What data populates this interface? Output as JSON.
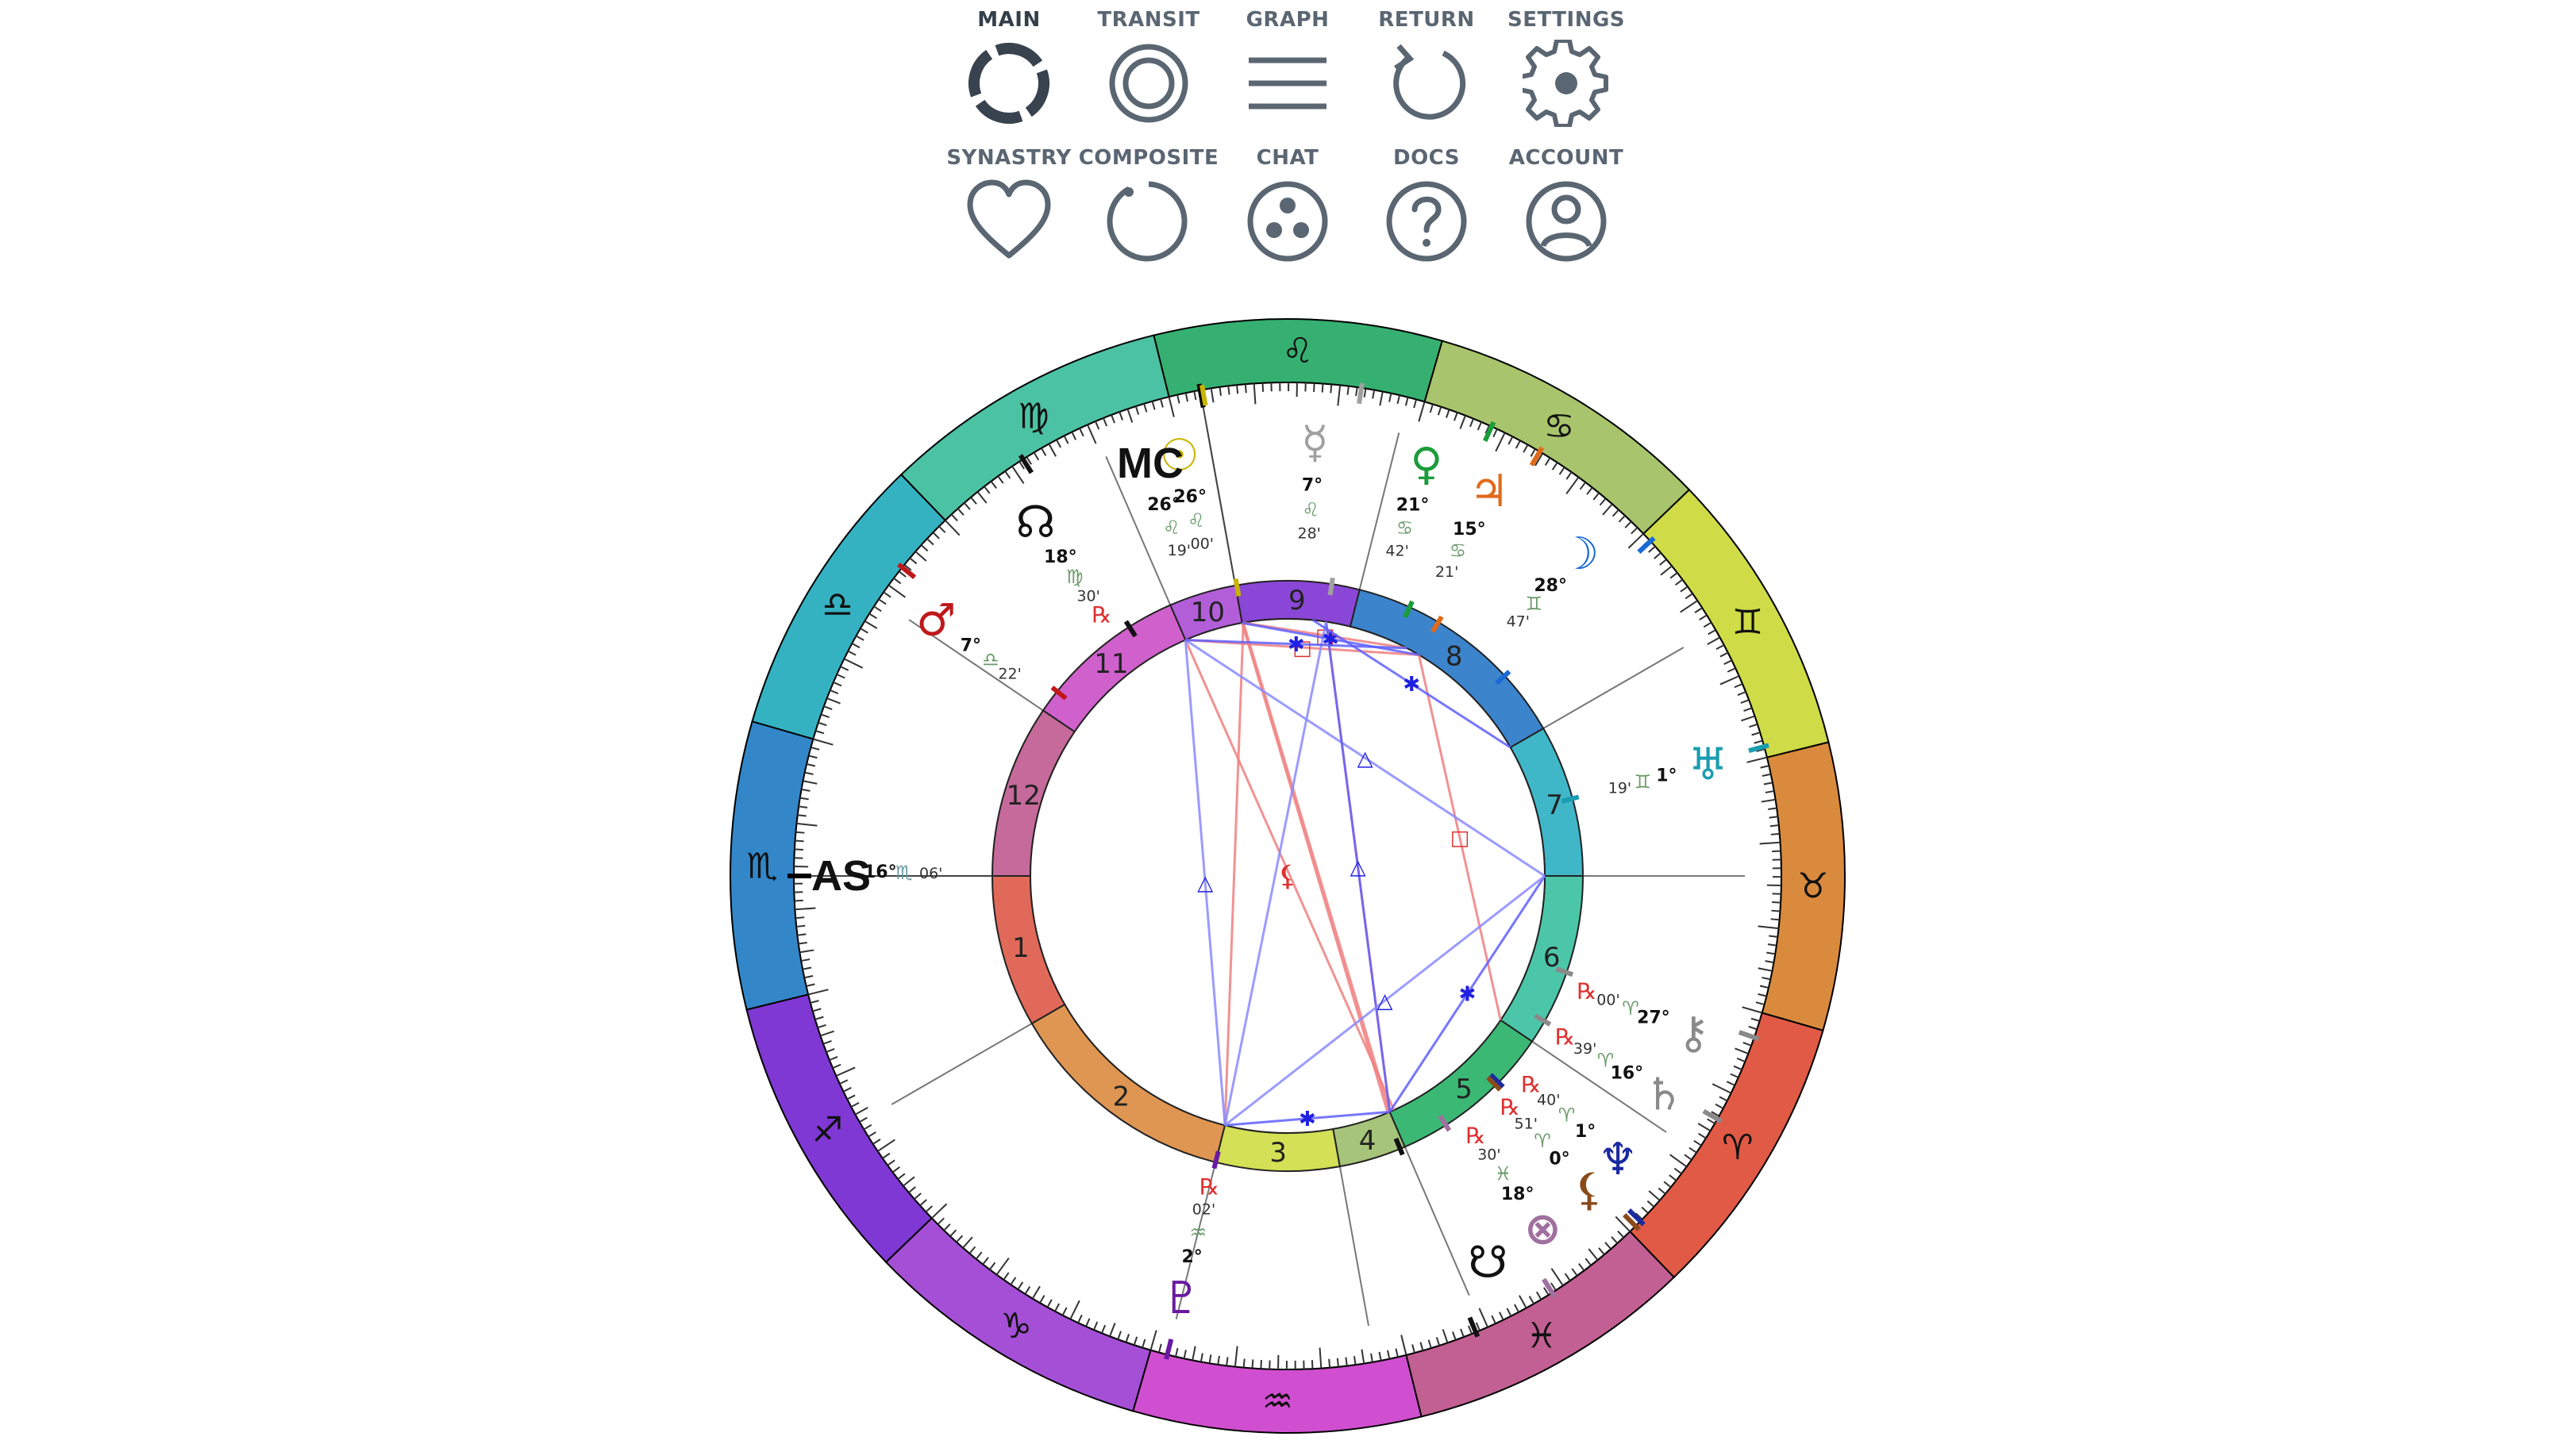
{
  "nav": [
    {
      "label": "MAIN",
      "icon": "main-chart-icon",
      "active": true
    },
    {
      "label": "TRANSIT",
      "icon": "transit-icon",
      "active": false
    },
    {
      "label": "GRAPH",
      "icon": "graph-lines-icon",
      "active": false
    },
    {
      "label": "RETURN",
      "icon": "return-arrow-icon",
      "active": false
    },
    {
      "label": "SETTINGS",
      "icon": "gear-icon",
      "active": false
    },
    {
      "label": "SYNASTRY",
      "icon": "heart-icon",
      "active": false
    },
    {
      "label": "COMPOSITE",
      "icon": "composite-circle-icon",
      "active": false
    },
    {
      "label": "CHAT",
      "icon": "chat-dots-icon",
      "active": false
    },
    {
      "label": "DOCS",
      "icon": "question-icon",
      "active": false
    },
    {
      "label": "ACCOUNT",
      "icon": "account-icon",
      "active": false
    }
  ],
  "chart": {
    "ascendant_longitude": 226.1,
    "signs": [
      {
        "name": "Aries",
        "glyph": "♈",
        "color": "#e05a45"
      },
      {
        "name": "Taurus",
        "glyph": "♉",
        "color": "#d98a3d"
      },
      {
        "name": "Gemini",
        "glyph": "♊",
        "color": "#cfdb47"
      },
      {
        "name": "Cancer",
        "glyph": "♋",
        "color": "#a8c46c"
      },
      {
        "name": "Leo",
        "glyph": "♌",
        "color": "#35b071"
      },
      {
        "name": "Virgo",
        "glyph": "♍",
        "color": "#4cc2a4"
      },
      {
        "name": "Libra",
        "glyph": "♎",
        "color": "#35b2c2"
      },
      {
        "name": "Scorpio",
        "glyph": "♏",
        "color": "#3387c8"
      },
      {
        "name": "Sagittarius",
        "glyph": "♐",
        "color": "#7f38d3"
      },
      {
        "name": "Capricorn",
        "glyph": "♑",
        "color": "#a44fd6"
      },
      {
        "name": "Aquarius",
        "glyph": "♒",
        "color": "#d04ed0"
      },
      {
        "name": "Pisces",
        "glyph": "♓",
        "color": "#c25f93"
      }
    ],
    "houses": [
      {
        "num": "1",
        "cusp": 226.1,
        "color": "#e0695a"
      },
      {
        "num": "2",
        "cusp": 256.1,
        "color": "#df9652"
      },
      {
        "num": "3",
        "cusp": 302.0,
        "color": "#d4e055"
      },
      {
        "num": "4",
        "cusp": 326.3,
        "color": "#a6c47a"
      },
      {
        "num": "5",
        "cusp": 339.5,
        "color": "#3cb875"
      },
      {
        "num": "6",
        "cusp": 12.0,
        "color": "#4cc6a9"
      },
      {
        "num": "7",
        "cusp": 46.1,
        "color": "#3fb7c8"
      },
      {
        "num": "8",
        "cusp": 76.1,
        "color": "#3c84cc"
      },
      {
        "num": "9",
        "cusp": 122.0,
        "color": "#8a46d6"
      },
      {
        "num": "10",
        "cusp": 146.3,
        "color": "#b35ed9"
      },
      {
        "num": "11",
        "cusp": 159.5,
        "color": "#cf60cc"
      },
      {
        "num": "12",
        "cusp": 192.0,
        "color": "#c56a9a"
      }
    ],
    "angles": [
      {
        "name": "AS",
        "glyph": "AS",
        "deg": "16°",
        "sign": "♏",
        "min": "06'",
        "lon": 226.1
      },
      {
        "name": "MC",
        "glyph": "MC",
        "deg": "26°",
        "sign": "♌",
        "min": "19'",
        "lon": 146.3
      }
    ],
    "planets": [
      {
        "name": "Sun",
        "glyph": "☉",
        "color": "#c8b400",
        "deg": "26°",
        "sign": "♌",
        "min": "00'",
        "retro": false,
        "lon": 146.0
      },
      {
        "name": "Mercury",
        "glyph": "☿",
        "color": "#a0a0a0",
        "deg": "7°",
        "sign": "♌",
        "min": "28'",
        "retro": false,
        "lon": 127.5
      },
      {
        "name": "Venus",
        "glyph": "♀",
        "color": "#1a9c3a",
        "deg": "21°",
        "sign": "♋",
        "min": "42'",
        "retro": false,
        "lon": 111.7
      },
      {
        "name": "Jupiter",
        "glyph": "♃",
        "color": "#e06a1a",
        "deg": "15°",
        "sign": "♋",
        "min": "21'",
        "retro": false,
        "lon": 105.4
      },
      {
        "name": "Moon",
        "glyph": "☽",
        "color": "#1a6ad4",
        "deg": "28°",
        "sign": "♊",
        "min": "47'",
        "retro": false,
        "lon": 88.8
      },
      {
        "name": "Uranus",
        "glyph": "♅",
        "color": "#1a9cb0",
        "deg": "1°",
        "sign": "♊",
        "min": "19'",
        "retro": false,
        "lon": 61.3
      },
      {
        "name": "Chiron",
        "glyph": "⚷",
        "color": "#8a8a8a",
        "deg": "27°",
        "sign": "♈",
        "min": "00'",
        "retro": true,
        "lon": 27.0
      },
      {
        "name": "Saturn",
        "glyph": "♄",
        "color": "#8a8a8a",
        "deg": "16°",
        "sign": "♈",
        "min": "39'",
        "retro": true,
        "lon": 16.6
      },
      {
        "name": "Neptune",
        "glyph": "♆",
        "color": "#1a2aa0",
        "deg": "1°",
        "sign": "♈",
        "min": "40'",
        "retro": true,
        "lon": 1.7
      },
      {
        "name": "Lilith",
        "glyph": "⚸",
        "color": "#8a4a1a",
        "deg": "0°",
        "sign": "♈",
        "min": "51'",
        "retro": true,
        "lon": 0.9
      },
      {
        "name": "Fortune",
        "glyph": "⊗",
        "color": "#a070a0",
        "deg": "18°",
        "sign": "♓",
        "min": "30'",
        "retro": true,
        "lon": 348.5
      },
      {
        "name": "South Node",
        "glyph": "☋",
        "color": "#111111",
        "deg": "",
        "sign": "",
        "min": "",
        "retro": false,
        "lon": 338.5
      },
      {
        "name": "Pluto",
        "glyph": "♇",
        "color": "#6a1aa0",
        "deg": "2°",
        "sign": "♒",
        "min": "02'",
        "retro": true,
        "lon": 302.0
      },
      {
        "name": "Mars",
        "glyph": "♂",
        "color": "#c0181a",
        "deg": "7°",
        "sign": "♎",
        "min": "22'",
        "retro": false,
        "lon": 187.4
      },
      {
        "name": "North Node",
        "glyph": "☊",
        "color": "#111111",
        "deg": "18°",
        "sign": "♍",
        "min": "30'",
        "retro": true,
        "lon": 168.5
      }
    ],
    "center_glyph": "⚸",
    "aspects": [
      {
        "a": 146.0,
        "b": 339.5,
        "kind": "opp",
        "color": "#f08080",
        "sym": ""
      },
      {
        "a": 146.3,
        "b": 339.0,
        "kind": "opp",
        "color": "#f08080",
        "sym": ""
      },
      {
        "a": 159.5,
        "b": 340.5,
        "kind": "opp",
        "color": "#f08080",
        "sym": ""
      },
      {
        "a": 159.5,
        "b": 105.4,
        "kind": "sq",
        "color": "#f08080",
        "sym": "□"
      },
      {
        "a": 146.0,
        "b": 108.5,
        "kind": "sq",
        "color": "#f08080",
        "sym": "□"
      },
      {
        "a": 105.4,
        "b": 12.0,
        "kind": "sq",
        "color": "#f08080",
        "sym": "□"
      },
      {
        "a": 146.0,
        "b": 302.0,
        "kind": "opp",
        "color": "#f08080",
        "sym": ""
      },
      {
        "a": 127.5,
        "b": 339.5,
        "kind": "opp",
        "color": "#f08080",
        "sym": ""
      },
      {
        "a": 159.5,
        "b": 302.0,
        "kind": "tri",
        "color": "#8a8aff",
        "sym": "△"
      },
      {
        "a": 159.5,
        "b": 46.1,
        "kind": "tri",
        "color": "#8a8aff",
        "sym": "△"
      },
      {
        "a": 127.5,
        "b": 339.5,
        "kind": "tri",
        "color": "#6060ff",
        "sym": "△"
      },
      {
        "a": 46.1,
        "b": 339.5,
        "kind": "sxt",
        "color": "#6060ff",
        "sym": "✱"
      },
      {
        "a": 302.0,
        "b": 339.5,
        "kind": "sxt",
        "color": "#6060ff",
        "sym": "✱"
      },
      {
        "a": 302.0,
        "b": 46.1,
        "kind": "tri",
        "color": "#8a8aff",
        "sym": "△"
      },
      {
        "a": 127.5,
        "b": 302.0,
        "kind": "tri",
        "color": "#8a8aff",
        "sym": ""
      },
      {
        "a": 146.3,
        "b": 105.4,
        "kind": "sxt",
        "color": "#6060ff",
        "sym": "✱"
      },
      {
        "a": 130.5,
        "b": 76.1,
        "kind": "sxt",
        "color": "#6060ff",
        "sym": "✱"
      },
      {
        "a": 159.5,
        "b": 108.5,
        "kind": "sxt",
        "color": "#6060ff",
        "sym": "✱"
      }
    ]
  }
}
